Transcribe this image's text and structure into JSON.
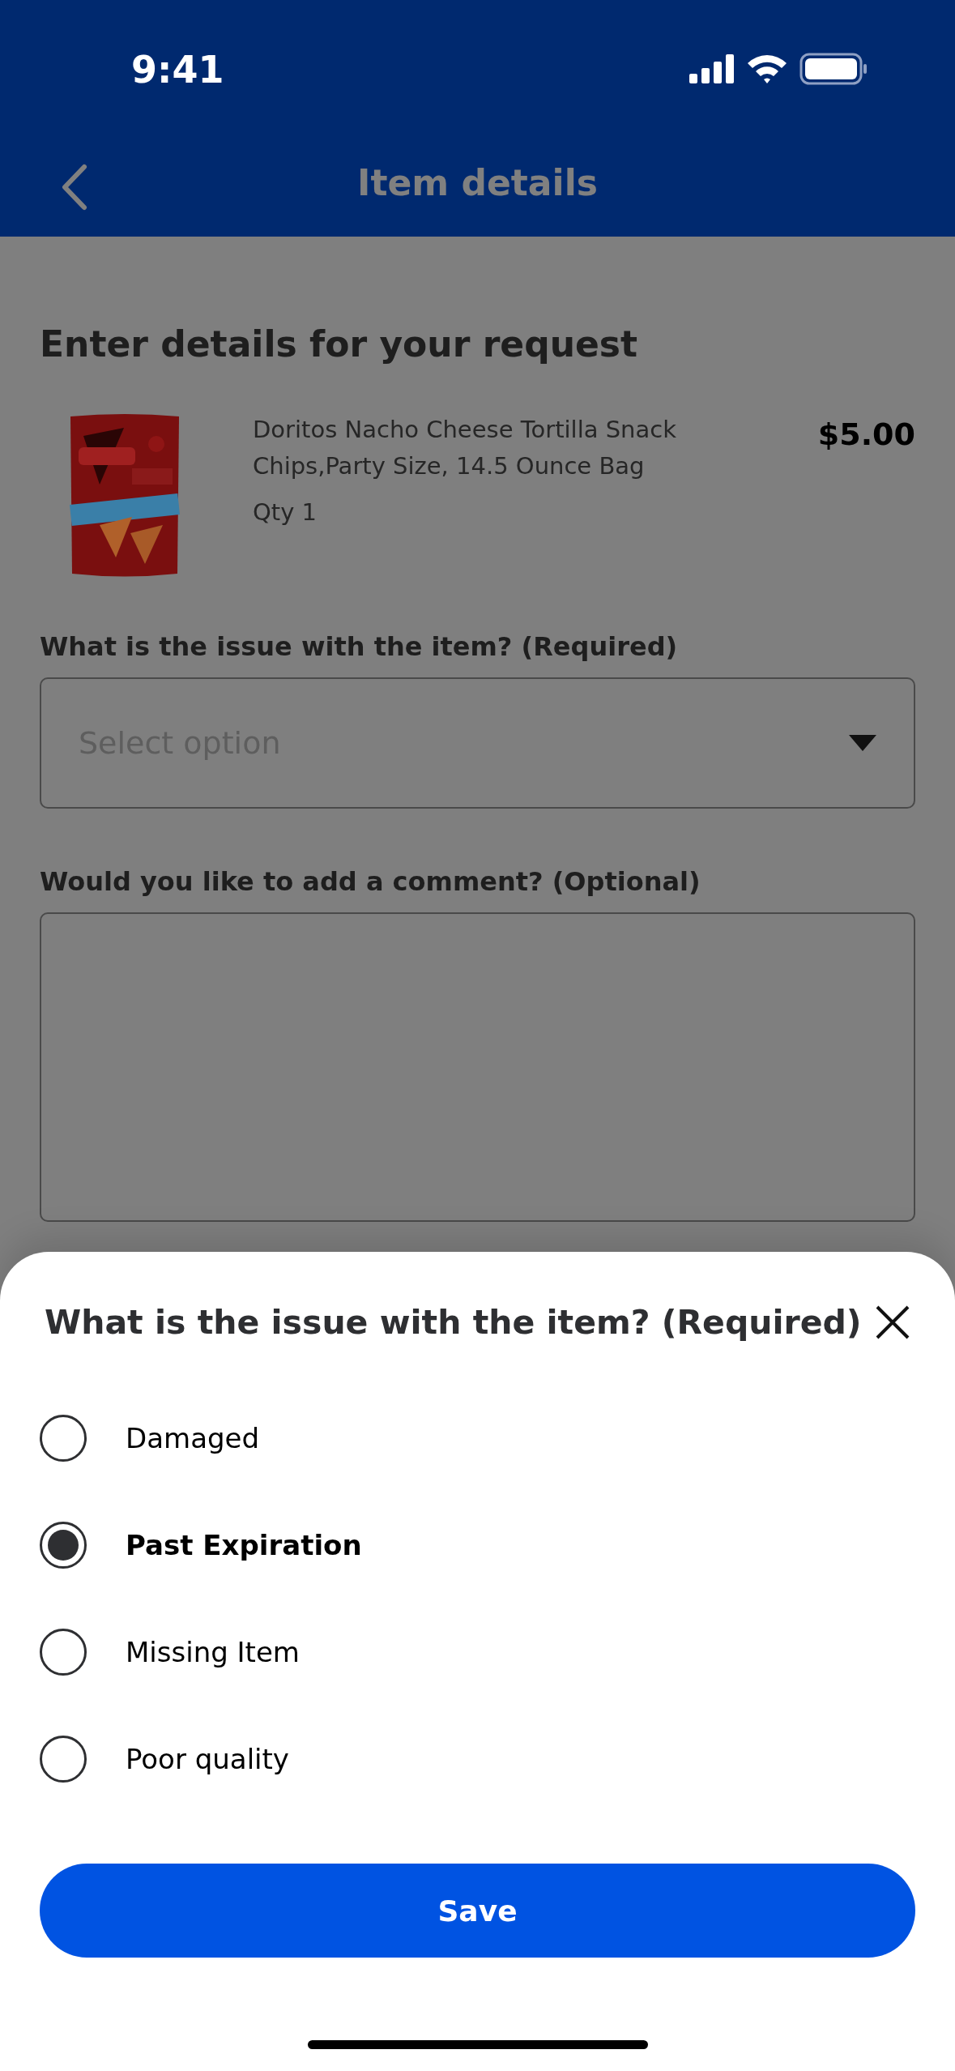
{
  "status_bar": {
    "time": "9:41"
  },
  "header": {
    "title": "Item details"
  },
  "form": {
    "heading": "Enter details for your request",
    "product": {
      "name": "Doritos Nacho Cheese Tortilla Snack Chips,Party Size, 14.5 Ounce Bag",
      "qty": "Qty 1",
      "price": "$5.00"
    },
    "issue_label": "What is the issue with the item? (Required)",
    "issue_select": {
      "placeholder": "Select option"
    },
    "comment_label": "Would you like to add a comment? (Optional)"
  },
  "sheet": {
    "title": "What is the issue with the item? (Required)",
    "options": [
      {
        "label": "Damaged",
        "selected": false
      },
      {
        "label": "Past Expiration",
        "selected": true
      },
      {
        "label": "Missing Item",
        "selected": false
      },
      {
        "label": "Poor quality",
        "selected": false
      }
    ],
    "save_button": "Save"
  }
}
